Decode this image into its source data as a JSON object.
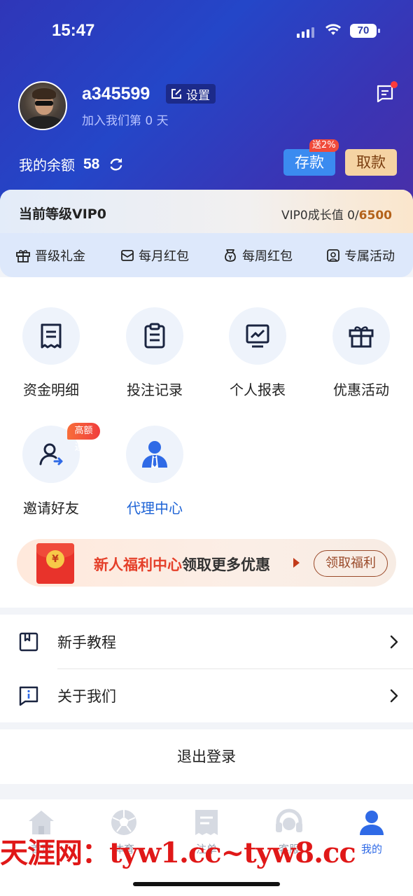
{
  "status_bar": {
    "time": "15:47",
    "battery": "70"
  },
  "profile": {
    "username": "a345599",
    "settings_label": "设置",
    "joined_text": "加入我们第 0 天",
    "balance_label": "我的余额",
    "balance_value": "58",
    "deposit_label": "存款",
    "deposit_badge": "送2%",
    "withdraw_label": "取款"
  },
  "vip": {
    "level_label": "当前等级VIP0",
    "growth_label": "VIP0成长值",
    "growth_current": "0/",
    "growth_target": "6500",
    "perks": [
      {
        "label": "晋级礼金",
        "icon": "gift-icon"
      },
      {
        "label": "每月红包",
        "icon": "envelope-icon"
      },
      {
        "label": "每周红包",
        "icon": "weekly-bag-icon"
      },
      {
        "label": "专属活动",
        "icon": "exclusive-icon"
      }
    ]
  },
  "grid": {
    "items": [
      {
        "label": "资金明细",
        "icon": "receipt-icon"
      },
      {
        "label": "投注记录",
        "icon": "clipboard-icon"
      },
      {
        "label": "个人报表",
        "icon": "chart-monitor-icon"
      },
      {
        "label": "优惠活动",
        "icon": "gift-box-icon"
      },
      {
        "label": "邀请好友",
        "icon": "invite-user-icon",
        "badge": "高额返佣"
      },
      {
        "label": "代理中心",
        "icon": "agent-icon"
      }
    ]
  },
  "banner": {
    "title_red": "新人福利中心",
    "title_dark": "领取更多优惠",
    "claim_label": "领取福利"
  },
  "menu": [
    {
      "label": "新手教程",
      "icon": "bookmark-book-icon"
    },
    {
      "label": "关于我们",
      "icon": "info-chat-icon"
    }
  ],
  "logout_label": "退出登录",
  "tabbar": {
    "tabs": [
      {
        "label": "首页",
        "icon": "home-icon"
      },
      {
        "label": "体育",
        "icon": "soccer-ball-icon"
      },
      {
        "label": "注单",
        "icon": "ticket-icon"
      },
      {
        "label": "客服",
        "icon": "headset-icon"
      },
      {
        "label": "我的",
        "icon": "user-icon",
        "active": true
      }
    ]
  },
  "watermark": "天涯网：tyw1.cc~tyw8.cc",
  "colors": {
    "header": "#2446c8",
    "accent": "#2f6ae6",
    "deposit": "#3b8bf0",
    "withdraw": "#f5d3a3",
    "red": "#e5402a"
  }
}
